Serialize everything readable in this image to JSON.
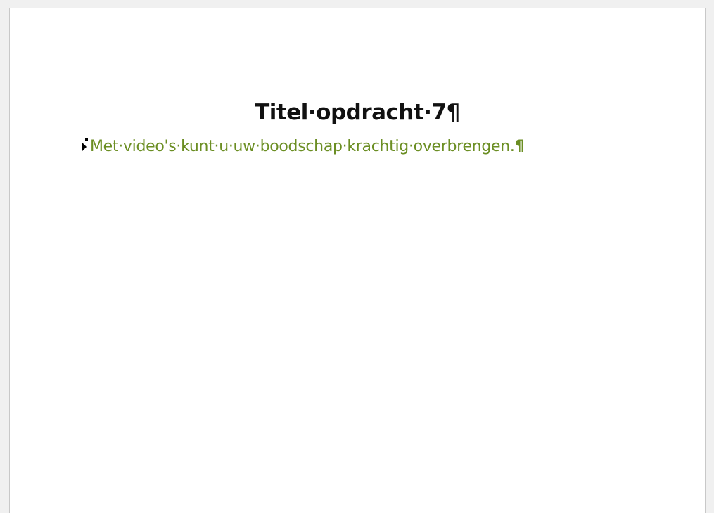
{
  "document": {
    "title": "Titel·opdracht·7¶",
    "bullet_text": "Met·video's·kunt·u·uw·boodschap·krachtig·overbrengen.¶"
  },
  "colors": {
    "title": "#111111",
    "body_text": "#6b8e23",
    "page_background": "#ffffff",
    "workspace_background": "#f0f0f0"
  },
  "icons": {
    "paragraph_marker": "collapse-triangle-icon"
  }
}
